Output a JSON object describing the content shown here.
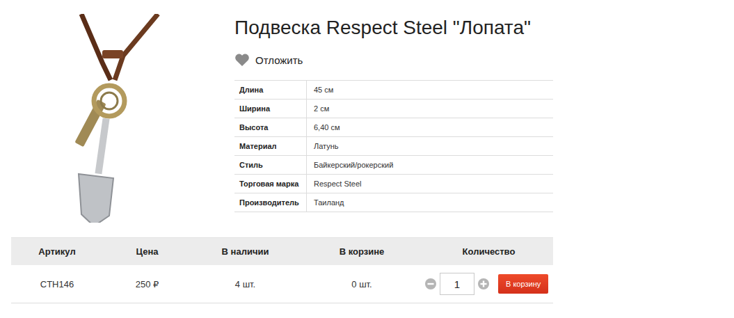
{
  "product": {
    "title": "Подвеска Respect Steel \"Лопата\"",
    "favorite_label": "Отложить"
  },
  "specs": [
    {
      "label": "Длина",
      "value": "45 см"
    },
    {
      "label": "Ширина",
      "value": "2 см"
    },
    {
      "label": "Высота",
      "value": "6,40 см"
    },
    {
      "label": "Материал",
      "value": "Латунь"
    },
    {
      "label": "Стиль",
      "value": "Байкерский/рокерский"
    },
    {
      "label": "Торговая марка",
      "value": "Respect Steel"
    },
    {
      "label": "Производитель",
      "value": "Таиланд"
    }
  ],
  "offer_table": {
    "columns": [
      "Артикул",
      "Цена",
      "В наличии",
      "В корзине",
      "Количество"
    ],
    "rows": [
      {
        "article": "CTH146",
        "price": "250 ₽",
        "stock": "4 шт.",
        "in_cart": "0 шт.",
        "quantity": "1",
        "button": "В корзину"
      }
    ]
  }
}
